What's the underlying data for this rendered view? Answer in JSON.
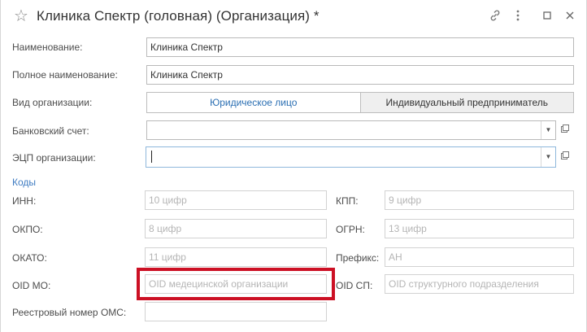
{
  "window": {
    "title": "Клиника Спектр  (головная) (Организация) *",
    "icons": {
      "favorite": "star-icon",
      "link": "link-icon",
      "more": "more-icon",
      "maximize": "maximize-icon",
      "close": "close-icon"
    }
  },
  "form": {
    "name": {
      "label": "Наименование:",
      "value": "Клиника Спектр"
    },
    "full_name": {
      "label": "Полное наименование:",
      "value": "Клиника Спектр"
    },
    "org_type": {
      "label": "Вид организации:",
      "options": [
        "Юридическое лицо",
        "Индивидуальный предприниматель"
      ],
      "selected": "Юридическое лицо"
    },
    "bank_account": {
      "label": "Банковский счет:",
      "value": ""
    },
    "signature": {
      "label": "ЭЦП организации:",
      "value": ""
    }
  },
  "codes": {
    "section_title": "Коды",
    "inn": {
      "label": "ИНН:",
      "placeholder": "10 цифр"
    },
    "kpp": {
      "label": "КПП:",
      "placeholder": "9 цифр"
    },
    "okpo": {
      "label": "ОКПО:",
      "placeholder": "8 цифр"
    },
    "ogrn": {
      "label": "ОГРН:",
      "placeholder": "13 цифр"
    },
    "okato": {
      "label": "ОКАТО:",
      "placeholder": "11 цифр"
    },
    "prefix": {
      "label": "Префикс:",
      "placeholder": "АН"
    },
    "oid_mo": {
      "label": "OID МО:",
      "placeholder": "OID медецинской организации"
    },
    "oid_sp": {
      "label": "OID СП:",
      "placeholder": "OID структурного подразделения"
    },
    "oms": {
      "label": "Реестровый номер ОМС:",
      "value": ""
    }
  },
  "colors": {
    "accent": "#2b6fb3",
    "section": "#3f7cc2",
    "highlight": "#cc1024"
  }
}
